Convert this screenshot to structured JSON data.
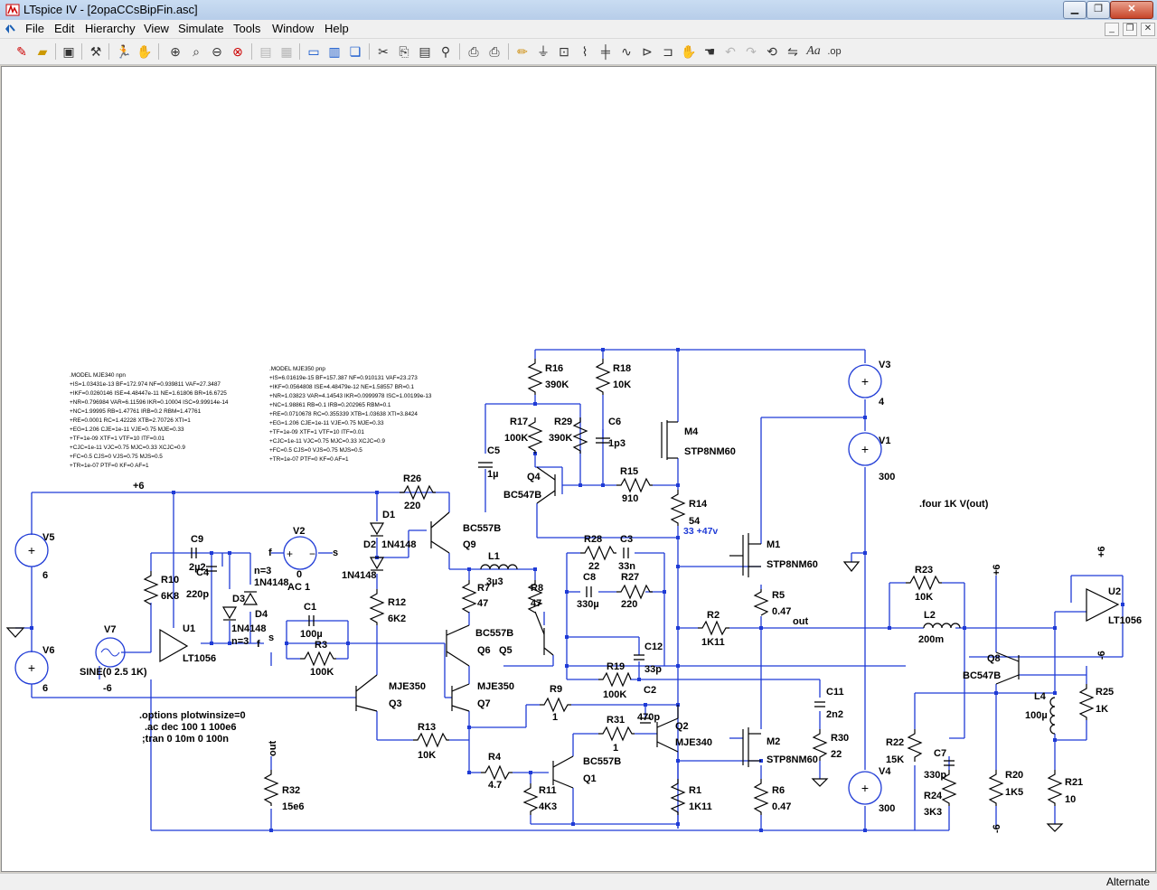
{
  "window": {
    "title": "LTspice IV - [2opaCCsBipFin.asc]"
  },
  "menu": {
    "items": [
      "File",
      "Edit",
      "Hierarchy",
      "View",
      "Simulate",
      "Tools",
      "Window",
      "Help"
    ]
  },
  "status": {
    "mode": "Alternate"
  },
  "schematic": {
    "model_npn": {
      "lines": [
        ".MODEL MJE340 npn",
        "+IS=1.03431e-13 BF=172.974 NF=0.939811 VAF=27.3487",
        "+IKF=0.0260146 ISE=4.48447e-11 NE=1.61806 BR=16.6725",
        "+NR=0.796984 VAR=6.11596 IKR=0.10004 ISC=9.99914e-14",
        "+NC=1.99995 RB=1.47761 IRB=0.2 RBM=1.47761",
        "+RE=0.0001 RC=1.42228 XTB=2.70726 XTI=1",
        "+EG=1.206 CJE=1e-11 VJE=0.75 MJE=0.33",
        "+TF=1e-09 XTF=1 VTF=10 ITF=0.01",
        "+CJC=1e-11 VJC=0.75 MJC=0.33 XCJC=0.9",
        "+FC=0.5 CJS=0 VJS=0.75 MJS=0.5",
        "+TR=1e-07 PTF=0 KF=0 AF=1"
      ]
    },
    "model_pnp": {
      "lines": [
        ".MODEL MJE350 pnp",
        "+IS=6.01619e-15 BF=157.387 NF=0.910131 VAF=23.273",
        "+IKF=0.0564808 ISE=4.48479e-12 NE=1.58557 BR=0.1",
        "+NR=1.03823 VAR=4.14543 IKR=0.0999978 ISC=1.00199e-13",
        "+NC=1.98861 RB=0.1 IRB=0.202965 RBM=0.1",
        "+RE=0.0710678 RC=0.355339 XTB=1.03638 XTI=3.8424",
        "+EG=1.206 CJE=1e-11 VJE=0.75 MJE=0.33",
        "+TF=1e-09 XTF=1 VTF=10 ITF=0.01",
        "+CJC=1e-11 VJC=0.75 MJC=0.33 XCJC=0.9",
        "+FC=0.5 CJS=0 VJS=0.75 MJS=0.5",
        "+TR=1e-07 PTF=0 KF=0 AF=1"
      ]
    },
    "directives": [
      ".options plotwinsize=0",
      ".ac dec 100 1 100e6",
      ";tran 0 10m 0 100n"
    ],
    "four_directive": ".four 1K V(out)",
    "voltage_annotation": "33 +47v",
    "labels": [
      {
        "id": "v3-name",
        "t": "V3"
      },
      {
        "id": "v3-val",
        "t": "4"
      },
      {
        "id": "v1-name",
        "t": "V1"
      },
      {
        "id": "v1-val",
        "t": "300"
      },
      {
        "id": "v4-name",
        "t": "V4"
      },
      {
        "id": "v4-val",
        "t": "300"
      },
      {
        "id": "v5-name",
        "t": "V5"
      },
      {
        "id": "v5-val",
        "t": "6"
      },
      {
        "id": "v6-name",
        "t": "V6"
      },
      {
        "id": "v6-val",
        "t": "6"
      },
      {
        "id": "v6-neg",
        "t": "-6"
      },
      {
        "id": "v7-name",
        "t": "V7"
      },
      {
        "id": "v7-val",
        "t": "SINE(0 2.5 1K)"
      },
      {
        "id": "v2-name",
        "t": "V2"
      },
      {
        "id": "v2-val",
        "t": "0"
      },
      {
        "id": "v2-ac",
        "t": "AC 1"
      },
      {
        "id": "v2-f",
        "t": "f"
      },
      {
        "id": "v2-s",
        "t": "s"
      },
      {
        "id": "r16-name",
        "t": "R16"
      },
      {
        "id": "r16-val",
        "t": "390K"
      },
      {
        "id": "r18-name",
        "t": "R18"
      },
      {
        "id": "r18-val",
        "t": "10K"
      },
      {
        "id": "r17-name",
        "t": "R17"
      },
      {
        "id": "r17-val",
        "t": "100K"
      },
      {
        "id": "r29-name",
        "t": "R29"
      },
      {
        "id": "r29-val",
        "t": "390K"
      },
      {
        "id": "c6-name",
        "t": "C6"
      },
      {
        "id": "c6-val",
        "t": "1p3"
      },
      {
        "id": "c5-name",
        "t": "C5"
      },
      {
        "id": "c5-val",
        "t": "1µ"
      },
      {
        "id": "q4-name",
        "t": "Q4"
      },
      {
        "id": "q4-val",
        "t": "BC547B"
      },
      {
        "id": "r15-name",
        "t": "R15"
      },
      {
        "id": "r15-val",
        "t": "910"
      },
      {
        "id": "m4-name",
        "t": "M4"
      },
      {
        "id": "m4-val",
        "t": "STP8NM60"
      },
      {
        "id": "r14-name",
        "t": "R14"
      },
      {
        "id": "r14-val",
        "t": "54"
      },
      {
        "id": "plus6",
        "t": "+6"
      },
      {
        "id": "r26-name",
        "t": "R26"
      },
      {
        "id": "r26-val",
        "t": "220"
      },
      {
        "id": "d1-name",
        "t": "D1"
      },
      {
        "id": "d2-name",
        "t": "D2"
      },
      {
        "id": "d2-val",
        "t": "1N4148"
      },
      {
        "id": "d1-val",
        "t": "1N4148"
      },
      {
        "id": "q9-val",
        "t": "BC557B"
      },
      {
        "id": "q9-name",
        "t": "Q9"
      },
      {
        "id": "l1-name",
        "t": "L1"
      },
      {
        "id": "l1-val",
        "t": "3µ3"
      },
      {
        "id": "r7-name",
        "t": "R7"
      },
      {
        "id": "r7-val",
        "t": "47"
      },
      {
        "id": "r8-name",
        "t": "R8"
      },
      {
        "id": "r8-val",
        "t": "47"
      },
      {
        "id": "r28-name",
        "t": "R28"
      },
      {
        "id": "r28-val",
        "t": "22"
      },
      {
        "id": "c3-name",
        "t": "C3"
      },
      {
        "id": "c3-val",
        "t": "33n"
      },
      {
        "id": "c8-name",
        "t": "C8"
      },
      {
        "id": "c8-val",
        "t": "330µ"
      },
      {
        "id": "r27-name",
        "t": "R27"
      },
      {
        "id": "r27-val",
        "t": "220"
      },
      {
        "id": "m1-name",
        "t": "M1"
      },
      {
        "id": "m1-val",
        "t": "STP8NM60"
      },
      {
        "id": "r5-name",
        "t": "R5"
      },
      {
        "id": "r5-val",
        "t": "0.47"
      },
      {
        "id": "out-label",
        "t": "out"
      },
      {
        "id": "r2-name",
        "t": "R2"
      },
      {
        "id": "r2-val",
        "t": "1K11"
      },
      {
        "id": "c9-name",
        "t": "C9"
      },
      {
        "id": "c9-val",
        "t": "2µ2"
      },
      {
        "id": "c4-name",
        "t": "C4"
      },
      {
        "id": "c4-val",
        "t": "220p"
      },
      {
        "id": "d3-name",
        "t": "D3"
      },
      {
        "id": "d4-name",
        "t": "D4"
      },
      {
        "id": "n3a",
        "t": "n=3"
      },
      {
        "id": "d4-val",
        "t": "1N4148"
      },
      {
        "id": "d3-val",
        "t": "1N4148"
      },
      {
        "id": "n3b",
        "t": "n=3"
      },
      {
        "id": "f-label",
        "t": "f"
      },
      {
        "id": "s-label",
        "t": "s"
      },
      {
        "id": "r10-name",
        "t": "R10"
      },
      {
        "id": "r10-val",
        "t": "6K8"
      },
      {
        "id": "u1-name",
        "t": "U1"
      },
      {
        "id": "u1-val",
        "t": "LT1056"
      },
      {
        "id": "r12-name",
        "t": "R12"
      },
      {
        "id": "r12-val",
        "t": "6K2"
      },
      {
        "id": "c1-name",
        "t": "C1"
      },
      {
        "id": "c1-val",
        "t": "100µ"
      },
      {
        "id": "r3-name",
        "t": "R3"
      },
      {
        "id": "r3-val",
        "t": "100K"
      },
      {
        "id": "q6-q5-val",
        "t": "BC557B"
      },
      {
        "id": "q6-name",
        "t": "Q6"
      },
      {
        "id": "q5-name",
        "t": "Q5"
      },
      {
        "id": "c12-name",
        "t": "C12"
      },
      {
        "id": "c12-val",
        "t": "33p"
      },
      {
        "id": "r19-name",
        "t": "R19"
      },
      {
        "id": "r19-val",
        "t": "100K"
      },
      {
        "id": "c11-name",
        "t": "C11"
      },
      {
        "id": "c11-val",
        "t": "2n2"
      },
      {
        "id": "q3-val",
        "t": "MJE350"
      },
      {
        "id": "q3-name",
        "t": "Q3"
      },
      {
        "id": "q7-val",
        "t": "MJE350"
      },
      {
        "id": "q7-name",
        "t": "Q7"
      },
      {
        "id": "r9-name",
        "t": "R9"
      },
      {
        "id": "r9-val",
        "t": "1"
      },
      {
        "id": "c2-name",
        "t": "C2"
      },
      {
        "id": "c2-val",
        "t": "470p"
      },
      {
        "id": "q2-name",
        "t": "Q2"
      },
      {
        "id": "q2-val",
        "t": "MJE340"
      },
      {
        "id": "r30-name",
        "t": "R30"
      },
      {
        "id": "r30-val",
        "t": "22"
      },
      {
        "id": "r31-name",
        "t": "R31"
      },
      {
        "id": "r31-val",
        "t": "1"
      },
      {
        "id": "r13-name",
        "t": "R13"
      },
      {
        "id": "r13-val",
        "t": "10K"
      },
      {
        "id": "m2-name",
        "t": "M2"
      },
      {
        "id": "m2-val",
        "t": "STP8NM60"
      },
      {
        "id": "q1-val",
        "t": "BC557B"
      },
      {
        "id": "q1-name",
        "t": "Q1"
      },
      {
        "id": "r4-name",
        "t": "R4"
      },
      {
        "id": "r4-val",
        "t": "4.7"
      },
      {
        "id": "r11-name",
        "t": "R11"
      },
      {
        "id": "r11-val",
        "t": "4K3"
      },
      {
        "id": "r1-name",
        "t": "R1"
      },
      {
        "id": "r1-val",
        "t": "1K11"
      },
      {
        "id": "r6-name",
        "t": "R6"
      },
      {
        "id": "r6-val",
        "t": "0.47"
      },
      {
        "id": "out-flag",
        "t": "out"
      },
      {
        "id": "r32-name",
        "t": "R32"
      },
      {
        "id": "r32-val",
        "t": "15e6"
      },
      {
        "id": "r23-name",
        "t": "R23"
      },
      {
        "id": "r23-val",
        "t": "10K"
      },
      {
        "id": "l2-name",
        "t": "L2"
      },
      {
        "id": "l2-val",
        "t": "200m"
      },
      {
        "id": "u2-name",
        "t": "U2"
      },
      {
        "id": "u2-val",
        "t": "LT1056"
      },
      {
        "id": "u2-pos",
        "t": "+6"
      },
      {
        "id": "u2-neg",
        "t": "-6"
      },
      {
        "id": "q8-pos",
        "t": "+6"
      },
      {
        "id": "q8-name",
        "t": "Q8"
      },
      {
        "id": "q8-val",
        "t": "BC547B"
      },
      {
        "id": "r25-name",
        "t": "R25"
      },
      {
        "id": "r25-val",
        "t": "1K"
      },
      {
        "id": "l4-name",
        "t": "L4"
      },
      {
        "id": "l4-val",
        "t": "100µ"
      },
      {
        "id": "r22-name",
        "t": "R22"
      },
      {
        "id": "r22-val",
        "t": "15K"
      },
      {
        "id": "c7-name",
        "t": "C7"
      },
      {
        "id": "c7-val",
        "t": "330p"
      },
      {
        "id": "r24-name",
        "t": "R24"
      },
      {
        "id": "r24-val",
        "t": "3K3"
      },
      {
        "id": "r20-name",
        "t": "R20"
      },
      {
        "id": "r20-val",
        "t": "1K5"
      },
      {
        "id": "r21-name",
        "t": "R21"
      },
      {
        "id": "r21-val",
        "t": "10"
      },
      {
        "id": "q8-neg",
        "t": "-6"
      }
    ]
  }
}
